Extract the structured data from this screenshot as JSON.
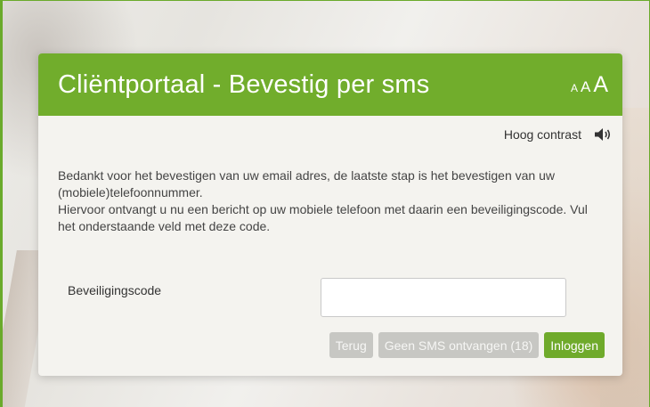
{
  "header": {
    "title": "Cliëntportaal - Bevestig per sms",
    "font_size_small": "A",
    "font_size_medium": "A",
    "font_size_large": "A"
  },
  "accessibility": {
    "contrast_label": "Hoog contrast",
    "speaker_icon": "speaker-icon"
  },
  "intro": {
    "paragraph_1": "Bedankt voor het bevestigen van uw email adres, de laatste stap is het bevestigen van uw (mobiele)telefoonnummer.",
    "paragraph_2": "Hiervoor ontvangt u nu een bericht op uw mobiele telefoon met daarin een beveiligingscode. Vul het onderstaande veld met deze code."
  },
  "form": {
    "code_label": "Beveiligingscode",
    "code_value": "",
    "code_placeholder": ""
  },
  "buttons": {
    "back_label": "Terug",
    "no_sms_label": "Geen SMS ontvangen (18)",
    "login_label": "Inloggen"
  },
  "colors": {
    "brand_green": "#71ad2c",
    "disabled_gray": "#c7c7c3"
  }
}
